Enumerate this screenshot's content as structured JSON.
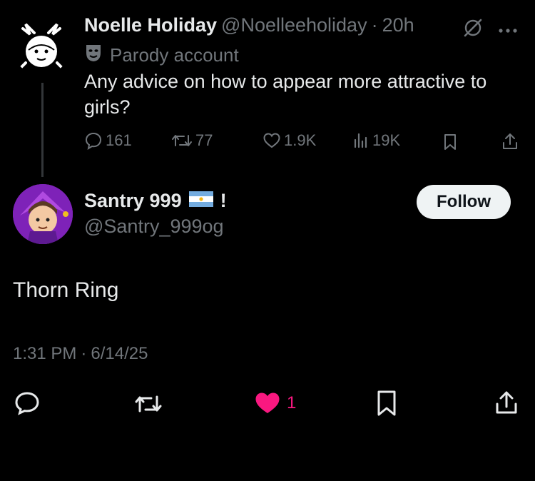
{
  "parent_tweet": {
    "author_name": "Noelle Holiday",
    "handle": "@Noelleeholiday",
    "separator": "·",
    "time_ago": "20h",
    "parody_label": "Parody account",
    "text": "Any advice on how to appear more attractive to girls?",
    "stats": {
      "replies": "161",
      "reposts": "77",
      "likes": "1.9K",
      "views": "19K"
    }
  },
  "reply_tweet": {
    "author_name": "Santry 999",
    "name_suffix": "!",
    "handle": "@Santry_999og",
    "follow_label": "Follow",
    "text": "Thorn Ring",
    "time": "1:31 PM",
    "separator": "·",
    "date": "6/14/25",
    "likes": "1"
  },
  "colors": {
    "background": "#000000",
    "text": "#e7e9ea",
    "muted": "#71767b",
    "like_active": "#f91880",
    "follow_bg": "#eff3f4",
    "avatar_purple": "#8a2bc9"
  },
  "icons": {
    "parent_stats": [
      "reply-icon",
      "repost-icon",
      "like-icon",
      "views-icon",
      "bookmark-icon",
      "share-icon"
    ],
    "reply_actions": [
      "reply-icon",
      "repost-icon",
      "heart-filled-icon",
      "bookmark-icon",
      "share-icon"
    ],
    "header": [
      "grok-icon",
      "more-icon"
    ],
    "flag": "argentina-flag-icon",
    "parody": "mask-icon"
  }
}
